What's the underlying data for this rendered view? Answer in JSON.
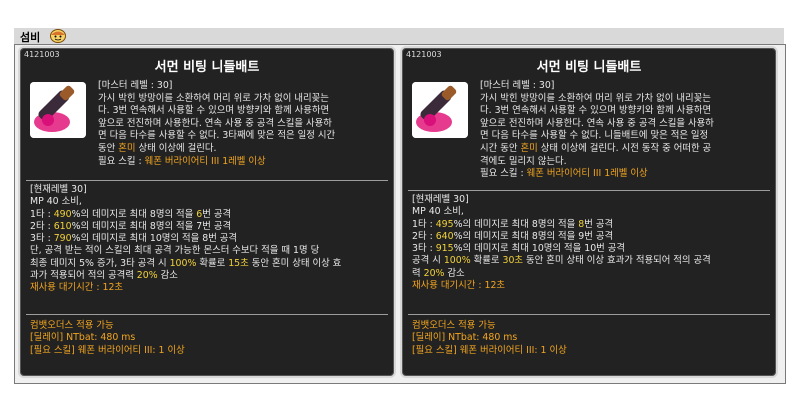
{
  "header": {
    "title": "섬비"
  },
  "tooltips": [
    {
      "id": "4121003",
      "name": "서먼 비팅 니들배트",
      "desc": {
        "master": "[마스터 레벨 : 30]",
        "lines": [
          "가시 박힌 방망이를 소환하여 머리 위로 가차 없이 내리꽂는",
          "다. 3번 연속해서 사용할 수 있으며 방향키와 함께 사용하면",
          "앞으로 전진하며 사용한다. 연속 사용 중 공격 스킬을 사용하",
          "면 다음 타수를 사용할 수 없다. 3타째에 맞은 적은 일정 시간",
          "동안 "
        ],
        "status_word": "혼미",
        "status_tail": " 상태 이상에 걸린다.",
        "req_prefix": "필요 스킬 : ",
        "req_skill": "웨폰 버라이어티 III 1레벨 이상"
      },
      "current": {
        "level": "[현재레벨 30]",
        "mp": "MP 40 소비,",
        "hit1_pre": "1타 : ",
        "hit1_pct": "490",
        "hit1_mid": "%의 데미지로 최대 8명의 적을 ",
        "hit1_n": "6",
        "hit1_post": "번 공격",
        "hit2_pre": "2타 : ",
        "hit2_pct": "610",
        "hit2_mid": "%의 데미지로 최대 8명의 적을 7번 공격",
        "hit3_pre": "3타 : ",
        "hit3_pct": "790",
        "hit3_mid": "%의 데미지로 최대 10명의 적을 8번 공격",
        "extra1": "단, 공격 받는 적이 스킬의 최대 공격 가능한 몬스터 수보다 적을 때 1명 당",
        "extra2_pre": "최종 데미지 5% 증가, 3타 공격 시 ",
        "extra2_pct": "100%",
        "extra2_mid": " 확률로 ",
        "extra2_sec": "15초",
        "extra2_post": " 동안 혼미 상태 이상 효",
        "extra3_pre": "과가 적용되어 적의 공격력 ",
        "extra3_pct": "20%",
        "extra3_post": " 감소",
        "cooldown": "재사용 대기시간 : 12초"
      },
      "footer": {
        "combo": "컴뱃오더스 적용 가능",
        "delay": "[딜레이] NTbat: 480 ms",
        "required": "[필요 스킬] 웨폰 버라이어티 III: 1 이상"
      }
    },
    {
      "id": "4121003",
      "name": "서먼 비팅 니들배트",
      "desc": {
        "master": "[마스터 레벨 : 30]",
        "lines": [
          "가시 박힌 방망이를 소환하여 머리 위로 가차 없이 내리꽂는",
          "다. 3번 연속해서 사용할 수 있으며 방향키와 함께 사용하면",
          "앞으로 전진하며 사용한다. 연속 사용 중 공격 스킬을 사용하",
          "면 다음 타수를 사용할 수 없다. 니들배트에 맞은 적은 일정",
          "시간 동안 "
        ],
        "status_word": "혼미",
        "status_tail": " 상태 이상에 걸린다. 시전 동작 중 어떠한 공",
        "extra_line": "격에도 밀리지 않는다.",
        "req_prefix": "필요 스킬 : ",
        "req_skill": "웨폰 버라이어티 III 1레벨 이상"
      },
      "current": {
        "level": "[현재레벨 30]",
        "mp": "MP 40 소비,",
        "hit1_pre": "1타 : ",
        "hit1_pct": "495",
        "hit1_mid": "%의 데미지로 최대 8명의 적을 ",
        "hit1_n": "8",
        "hit1_post": "번 공격",
        "hit2_pre": "2타 : ",
        "hit2_pct": "640",
        "hit2_mid": "%의 데미지로 최대 8명의 적을 9번 공격",
        "hit3_pre": "3타 : ",
        "hit3_pct": "915",
        "hit3_mid": "%의 데미지로 최대 10명의 적을 10번 공격",
        "extra1_pre": "공격 시 ",
        "extra1_pct": "100%",
        "extra1_mid": " 확률로 ",
        "extra1_sec": "30초",
        "extra1_post": " 동안 혼미 상태 이상 효과가 적용되어 적의 공격",
        "extra2_pre": "력 ",
        "extra2_pct": "20%",
        "extra2_post": " 감소",
        "cooldown": "재사용 대기시간 : 12초"
      },
      "footer": {
        "combo": "컴뱃오더스 적용 가능",
        "delay": "[딜레이] NTbat: 480 ms",
        "required": "[필요 스킬] 웨폰 버라이어티 III: 1 이상"
      }
    }
  ],
  "colors": {
    "panel_bg": "#222222",
    "accent_orange": "#f2a51f",
    "number_yellow": "#f2d23a"
  },
  "icons": {
    "header_face": "emoticon-face-icon",
    "skill": "needle-bat-skill-icon"
  }
}
